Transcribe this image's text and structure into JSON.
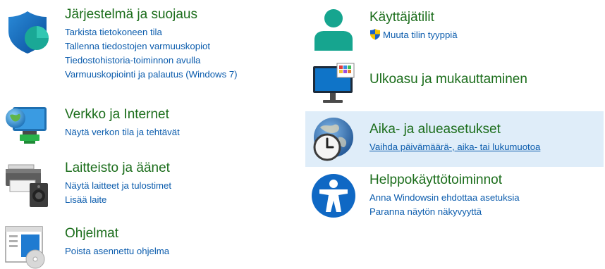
{
  "left": {
    "system": {
      "title": "Järjestelmä ja suojaus",
      "links": [
        "Tarkista tietokoneen tila",
        "Tallenna tiedostojen varmuuskopiot",
        "Tiedostohistoria-toiminnon avulla",
        "Varmuuskopiointi ja palautus (Windows 7)"
      ]
    },
    "network": {
      "title": "Verkko ja Internet",
      "links": [
        "Näytä verkon tila ja tehtävät"
      ]
    },
    "hardware": {
      "title": "Laitteisto ja äänet",
      "links": [
        "Näytä laitteet ja tulostimet",
        "Lisää laite"
      ]
    },
    "programs": {
      "title": "Ohjelmat",
      "links": [
        "Poista asennettu ohjelma"
      ]
    }
  },
  "right": {
    "accounts": {
      "title": "Käyttäjätilit",
      "links": [
        "Muuta tilin tyyppiä"
      ]
    },
    "appearance": {
      "title": "Ulkoasu ja mukauttaminen"
    },
    "clock": {
      "title": "Aika- ja alueasetukset",
      "links": [
        "Vaihda päivämäärä-, aika- tai lukumuotoa"
      ]
    },
    "ease": {
      "title": "Helppokäyttötoiminnot",
      "links": [
        "Anna Windowsin ehdottaa asetuksia",
        "Paranna näytön näkyvyyttä"
      ]
    }
  },
  "colors": {
    "title": "#1b6d1b",
    "link": "#0b5cad",
    "highlight": "#dfedf9"
  }
}
